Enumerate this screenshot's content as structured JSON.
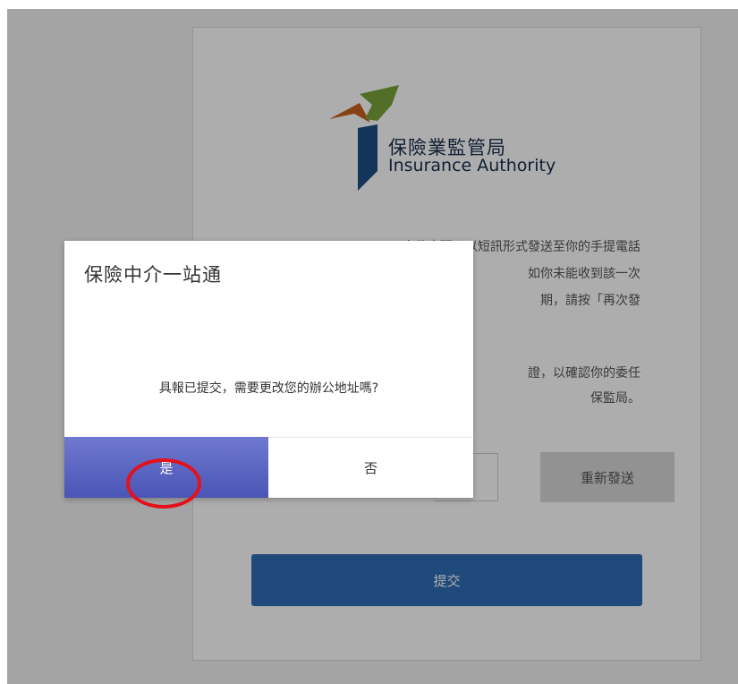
{
  "background_card": {
    "logo": {
      "name_cn": "保險業監管局",
      "name_en": "Insurance Authority"
    },
    "description_lines": [
      "文件密碼已以短訊形式發送至你的手提電話",
      "如你未能收到該一次",
      "期，請按「再次發"
    ],
    "description2_lines": [
      "證，以確認你的委任",
      "保監局。"
    ],
    "resend_label": "重新發送",
    "submit_label": "提交"
  },
  "dialog": {
    "title": "保險中介一站通",
    "message": "具報已提交，需要更改您的辦公地址嗎?",
    "yes_label": "是",
    "no_label": "否"
  },
  "colors": {
    "logo_orange": "#c8621d",
    "logo_green": "#7aa33a",
    "logo_blue": "#1e4e85",
    "yes_button": "#5863bf",
    "submit_button": "#2e6db5",
    "highlight": "#e3111b"
  }
}
